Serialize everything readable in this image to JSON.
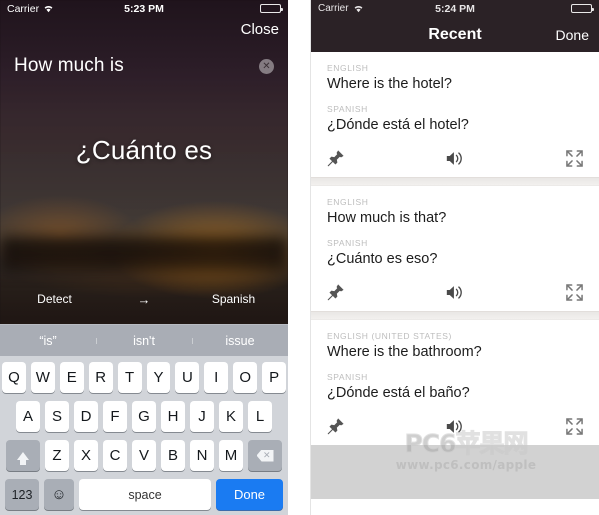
{
  "left_phone": {
    "status_bar": {
      "carrier": "Carrier",
      "wifi_icon": "wifi-icon",
      "time": "5:23 PM",
      "battery_icon": "battery-full-icon"
    },
    "close_label": "Close",
    "source_text": "How much is",
    "clear_icon": "clear-circle-x-icon",
    "translated_text": "¿Cuánto es",
    "source_language": "Detect",
    "direction_arrow": "→",
    "target_language": "Spanish",
    "keyboard": {
      "suggestions": [
        "“is”",
        "isn't",
        "issue"
      ],
      "row1": [
        "Q",
        "W",
        "E",
        "R",
        "T",
        "Y",
        "U",
        "I",
        "O",
        "P"
      ],
      "row2": [
        "A",
        "S",
        "D",
        "F",
        "G",
        "H",
        "J",
        "K",
        "L"
      ],
      "row3": [
        "Z",
        "X",
        "C",
        "V",
        "B",
        "N",
        "M"
      ],
      "shift_icon": "shift-arrow-up-icon",
      "delete_icon": "backspace-delete-icon",
      "numeric_label": "123",
      "emoji_icon": "emoji-smiley-icon",
      "space_label": "space",
      "done_label": "Done",
      "done_color": "#1a7bf2"
    }
  },
  "right_phone": {
    "status_bar": {
      "carrier": "Carrier",
      "wifi_icon": "wifi-icon",
      "time": "5:24 PM",
      "battery_icon": "battery-full-icon"
    },
    "nav": {
      "title": "Recent",
      "done_label": "Done"
    },
    "cards": [
      {
        "source_label": "ENGLISH",
        "source_phrase": "Where is the hotel?",
        "target_label": "SPANISH",
        "target_phrase": "¿Dónde está el hotel?",
        "pin_icon": "pin-icon",
        "speaker_icon": "speaker-volume-icon",
        "expand_icon": "expand-fullscreen-icon"
      },
      {
        "source_label": "ENGLISH",
        "source_phrase": "How much is that?",
        "target_label": "SPANISH",
        "target_phrase": "¿Cuánto es eso?",
        "pin_icon": "pin-icon",
        "speaker_icon": "speaker-volume-icon",
        "expand_icon": "expand-fullscreen-icon"
      },
      {
        "source_label": "ENGLISH (UNITED STATES)",
        "source_phrase": "Where is the bathroom?",
        "target_label": "SPANISH",
        "target_phrase": "¿Dónde está el baño?",
        "pin_icon": "pin-icon",
        "speaker_icon": "speaker-volume-icon",
        "expand_icon": "expand-fullscreen-icon"
      }
    ]
  },
  "watermark": {
    "main": "PC6苹果网",
    "sub": "www.pc6.com/apple"
  }
}
